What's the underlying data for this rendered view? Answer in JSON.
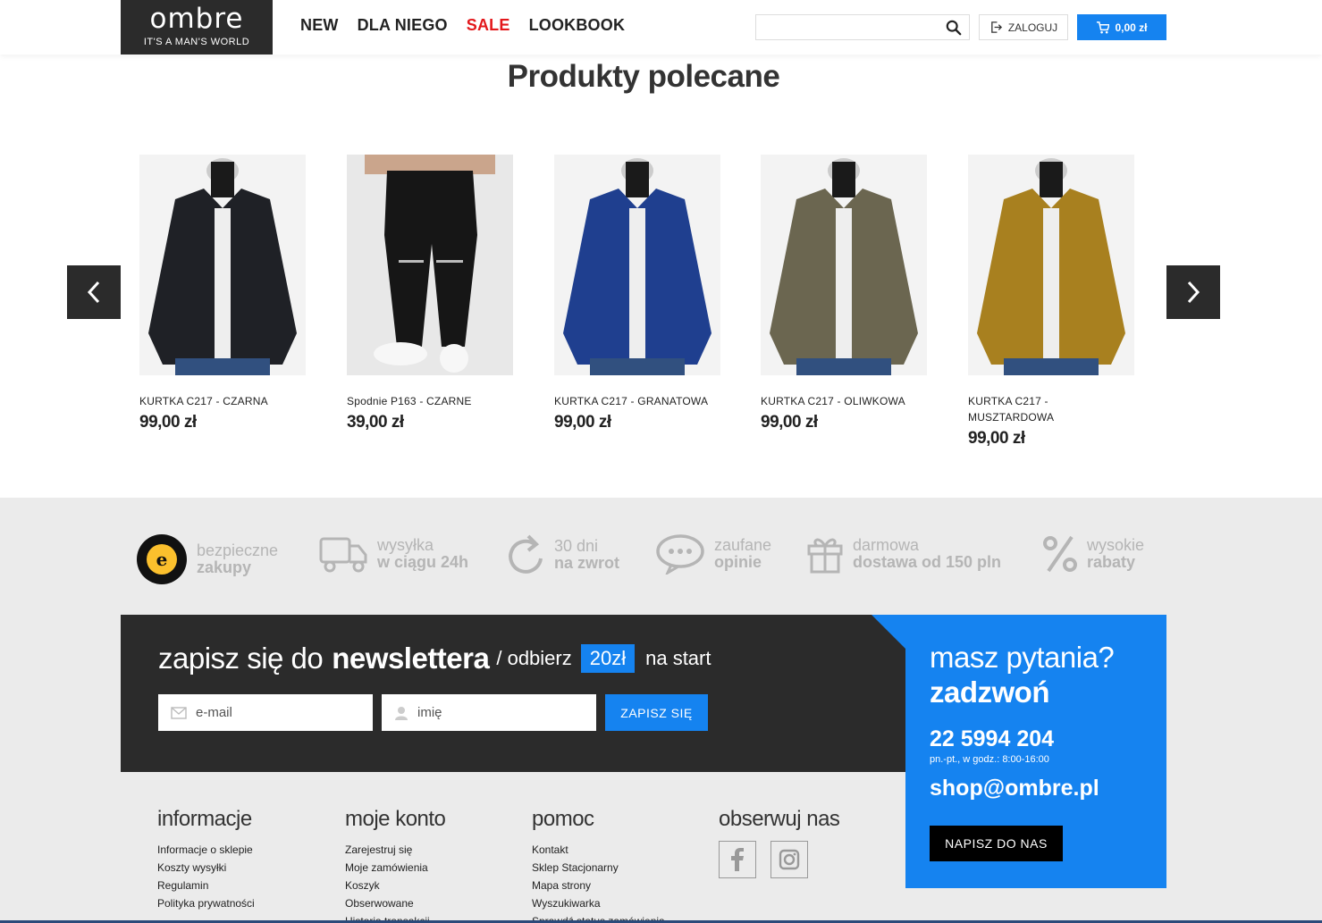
{
  "header": {
    "logo_brand": "ombre",
    "logo_tagline": "IT'S A MAN'S WORLD",
    "nav": [
      "NEW",
      "DLA NIEGO",
      "SALE",
      "LOOKBOOK"
    ],
    "search_placeholder": "",
    "login_label": "ZALOGUJ",
    "cart_label": "0,00 zł",
    "colors": {
      "sale": "#e3181c",
      "accent": "#1583f0",
      "dark": "#2b2b2b"
    }
  },
  "featured": {
    "title": "Produkty polecane",
    "products": [
      {
        "name": "KURTKA C217 - CZARNA",
        "price": "99,00 zł",
        "color": "#1f2126"
      },
      {
        "name": "Spodnie P163 - CZARNE",
        "price": "39,00 zł",
        "color": "#161616"
      },
      {
        "name": "KURTKA C217 - GRANATOWA",
        "price": "99,00 zł",
        "color": "#1f3f8f"
      },
      {
        "name": "KURTKA C217 - OLIWKOWA",
        "price": "99,00 zł",
        "color": "#6b6650"
      },
      {
        "name": "KURTKA C217 - MUSZTARDOWA",
        "price": "99,00 zł",
        "color": "#a8801f"
      }
    ]
  },
  "benefits": [
    {
      "icon": "trusted-shops-icon",
      "line1": "bezpieczne",
      "line2": "zakupy"
    },
    {
      "icon": "truck-icon",
      "line1": "wysyłka",
      "line2": "w ciągu 24h"
    },
    {
      "icon": "return-icon",
      "line1": "30 dni",
      "line2": "na zwrot"
    },
    {
      "icon": "chat-icon",
      "line1": "zaufane",
      "line2": "opinie"
    },
    {
      "icon": "gift-icon",
      "line1": "darmowa",
      "line2": "dostawa od 150 pln"
    },
    {
      "icon": "percent-icon",
      "line1": "wysokie",
      "line2": "rabaty"
    }
  ],
  "newsletter": {
    "part1": "zapisz się do",
    "part2": "newslettera",
    "part3": "/ odbierz",
    "badge": "20zł",
    "part4": "na start",
    "email_placeholder": "e-mail",
    "name_placeholder": "imię",
    "submit": "ZAPISZ SIĘ"
  },
  "contact": {
    "question": "masz pytania?",
    "call": "zadzwoń",
    "phone": "22 5994 204",
    "hours": "pn.-pt., w godz.: 8:00-16:00",
    "email": "shop@ombre.pl",
    "button": "NAPISZ DO NAS"
  },
  "footer": {
    "informacje": {
      "title": "informacje",
      "links": [
        "Informacje o sklepie",
        "Koszty wysyłki",
        "Regulamin",
        "Polityka prywatności"
      ]
    },
    "konto": {
      "title": "moje konto",
      "links": [
        "Zarejestruj się",
        "Moje zamówienia",
        "Koszyk",
        "Obserwowane",
        "Historia transakcji"
      ]
    },
    "pomoc": {
      "title": "pomoc",
      "links": [
        "Kontakt",
        "Sklep Stacjonarny",
        "Mapa strony",
        "Wyszukiwarka",
        "Sprawdź status zamówienia"
      ]
    },
    "social": {
      "title": "obserwuj nas"
    }
  }
}
